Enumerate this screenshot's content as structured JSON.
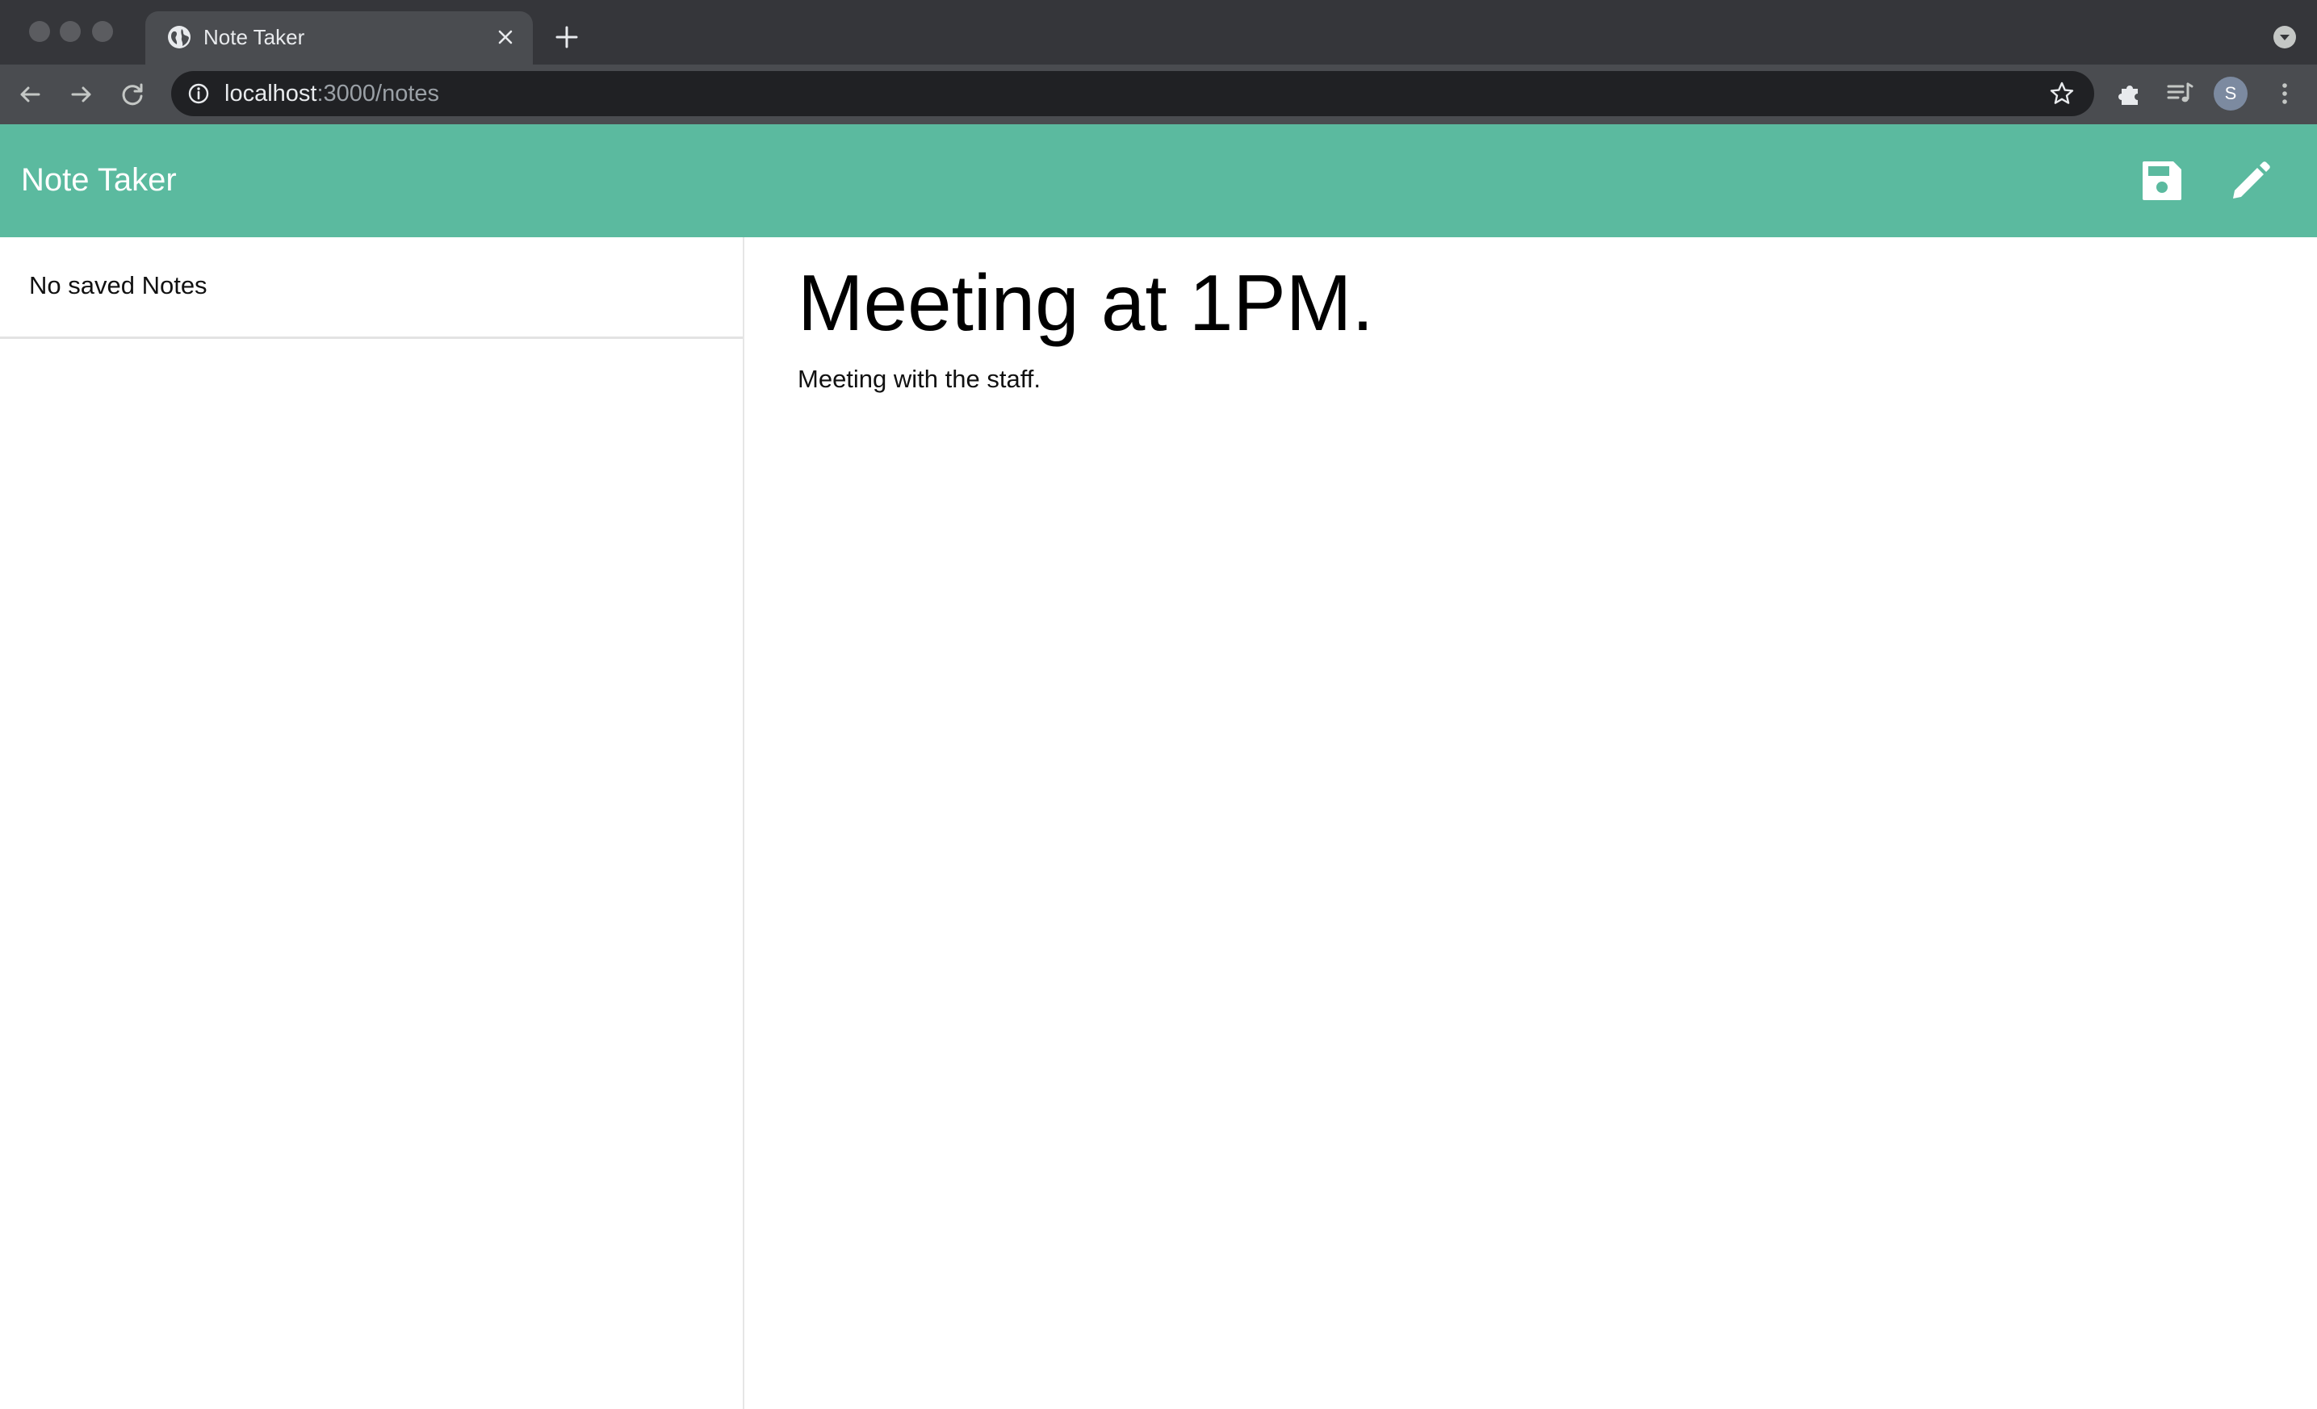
{
  "browser": {
    "tab_title": "Note Taker",
    "url_host": "localhost",
    "url_path": ":3000/notes",
    "profile_initial": "S"
  },
  "app": {
    "brand": "Note Taker",
    "accent_color": "#5bba9f"
  },
  "sidebar": {
    "empty_message": "No saved Notes"
  },
  "note": {
    "title": "Meeting at 1PM.",
    "body": "Meeting with the staff."
  },
  "icons": {
    "save": "save-icon",
    "edit": "pencil-icon"
  }
}
